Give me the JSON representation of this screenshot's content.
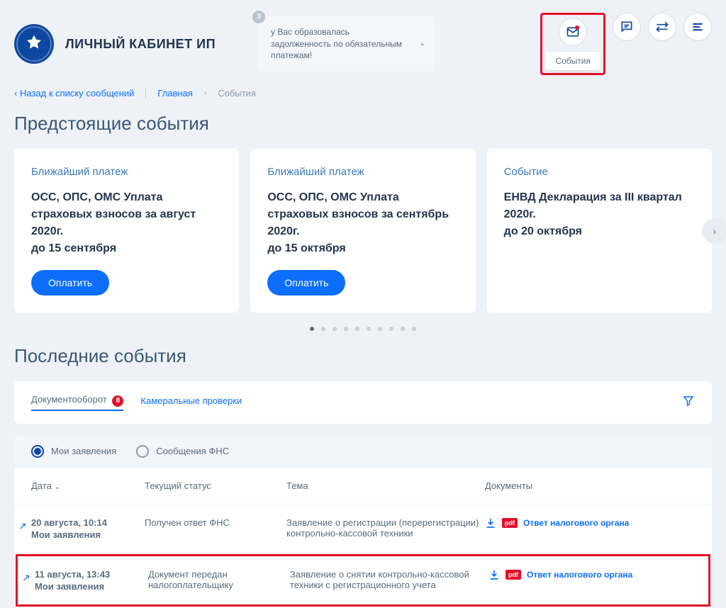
{
  "header": {
    "app_title": "ЛИЧНЫЙ КАБИНЕТ ИП",
    "notification": {
      "badge": "3",
      "text": "у Вас образовалась задолженность по обязательным платежам!"
    },
    "events_label": "События"
  },
  "breadcrumb": {
    "back": "Назад к списку сообщений",
    "home": "Главная",
    "current": "События"
  },
  "upcoming": {
    "title": "Предстоящие события",
    "cards": [
      {
        "tag": "Ближайший платеж",
        "line1": "ОСС, ОПС, ОМС Уплата страховых взносов за август 2020г.",
        "line2": "до 15 сентября",
        "button": "Оплатить"
      },
      {
        "tag": "Ближайший платеж",
        "line1": "ОСС, ОПС, ОМС Уплата страховых взносов за сентябрь 2020г.",
        "line2": "до 15 октября",
        "button": "Оплатить"
      },
      {
        "tag": "Событие",
        "line1": "ЕНВД Декларация за III квартал 2020г.",
        "line2": "до 20 октября",
        "button": null
      }
    ]
  },
  "recent": {
    "title": "Последние события",
    "tabs": [
      {
        "label": "Документооборот",
        "badge": "8",
        "active": true
      },
      {
        "label": "Камеральные проверки",
        "badge": null,
        "active": false
      }
    ],
    "filters": [
      {
        "label": "Мои заявления",
        "checked": true
      },
      {
        "label": "Сообщения ФНС",
        "checked": false
      }
    ],
    "columns": {
      "date": "Дата",
      "status": "Текущий статус",
      "topic": "Тема",
      "docs": "Документы"
    },
    "rows": [
      {
        "date": "20 августа, 10:14",
        "sub": "Мои заявления",
        "status": "Получен ответ ФНС",
        "topic": "Заявление о регистрации (перерегистрации) контрольно-кассовой техники",
        "doc_label": "Ответ налогового органа",
        "pdf": "pdf",
        "highlighted": false
      },
      {
        "date": "11 августа, 13:43",
        "sub": "Мои заявления",
        "status": "Документ передан налогоплательщику",
        "topic": "Заявление о снятии контрольно-кассовой техники с регистрационного учета",
        "doc_label": "Ответ налогового органа",
        "pdf": "pdf",
        "highlighted": true
      }
    ]
  }
}
